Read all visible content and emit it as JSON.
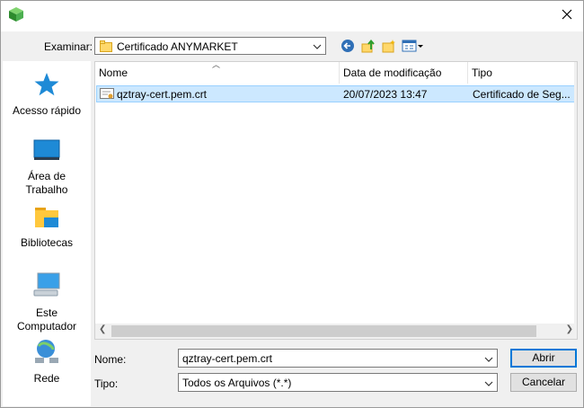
{
  "titlebar": {
    "app_icon": "cube-icon",
    "close_icon": "close-icon"
  },
  "lookin": {
    "label": "Examinar:",
    "value": "Certificado ANYMARKET",
    "folder_icon": "folder-icon"
  },
  "toolbar": {
    "icons": [
      "back-icon",
      "up-folder-icon",
      "new-folder-icon",
      "view-menu-icon"
    ]
  },
  "places": [
    {
      "label": "Acesso rápido",
      "icon": "star-icon"
    },
    {
      "label": "Área de Trabalho",
      "icon": "desktop-icon"
    },
    {
      "label": "Bibliotecas",
      "icon": "libraries-icon"
    },
    {
      "label": "Este Computador",
      "icon": "computer-icon"
    },
    {
      "label": "Rede",
      "icon": "network-icon"
    }
  ],
  "columns": [
    "Nome",
    "Data de modificação",
    "Tipo"
  ],
  "files": [
    {
      "name": "qztray-cert.pem.crt",
      "modified": "20/07/2023 13:47",
      "type": "Certificado de Seg...",
      "icon": "certificate-icon"
    }
  ],
  "form": {
    "name_label": "Nome:",
    "name_value": "qztray-cert.pem.crt",
    "type_label": "Tipo:",
    "type_value": "Todos os Arquivos (*.*)"
  },
  "buttons": {
    "open": "Abrir",
    "cancel": "Cancelar"
  },
  "colors": {
    "selection": "#cce8ff",
    "accent": "#0078d7"
  }
}
